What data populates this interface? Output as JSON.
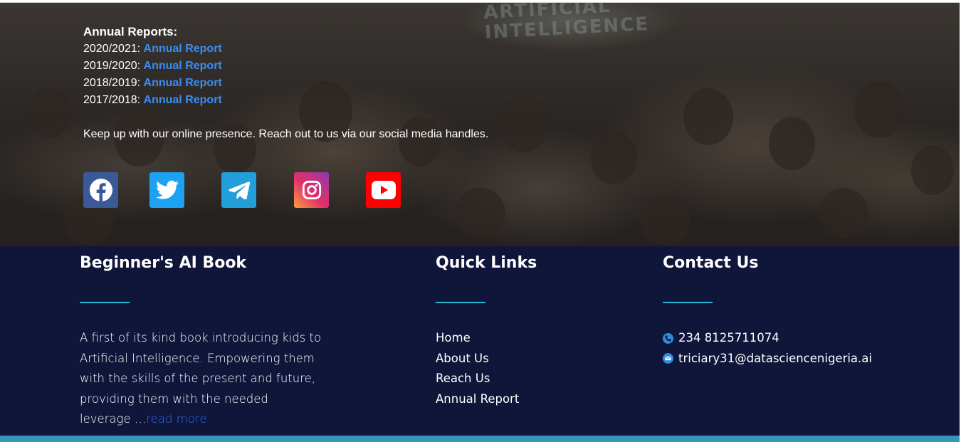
{
  "annual_reports": {
    "heading": "Annual Reports:",
    "items": [
      {
        "year": "2020/2021:",
        "link_label": "Annual Report"
      },
      {
        "year": "2019/2020:",
        "link_label": "Annual Report"
      },
      {
        "year": "2018/2019:",
        "link_label": "Annual Report"
      },
      {
        "year": "2017/2018:",
        "link_label": "Annual Report"
      }
    ]
  },
  "presence_text": "Keep up with our online presence. Reach out to us via our social media handles.",
  "socials": [
    {
      "icon": "facebook-icon",
      "color": "#3b5998"
    },
    {
      "icon": "twitter-icon",
      "color": "#1da1f2"
    },
    {
      "icon": "telegram-icon",
      "color": "#229ed9"
    },
    {
      "icon": "instagram-icon",
      "color": "#e1306c"
    },
    {
      "icon": "youtube-icon",
      "color": "#ff0000"
    }
  ],
  "footer": {
    "book": {
      "title": "Beginner's AI Book",
      "line1": "A first of its kind book introducing kids to",
      "line2": "Artificial Intelligence. Empowering them",
      "line3": "with the skills of the present and future,",
      "line4": "providing them with the needed",
      "line5": "leverage …",
      "read_more": "read more"
    },
    "quick_links": {
      "title": "Quick Links",
      "items": [
        "Home",
        "About Us",
        "Reach Us",
        "Annual Report"
      ]
    },
    "contact": {
      "title": "Contact Us",
      "phone": "234 8125711074",
      "email": "triciary31@datasciencenigeria.ai"
    }
  },
  "colors": {
    "footer_bg": "#10153a",
    "accent_underline": "#29b7d3",
    "link_blue": "#3a8df4",
    "bottom_strip": "#3795b6"
  }
}
